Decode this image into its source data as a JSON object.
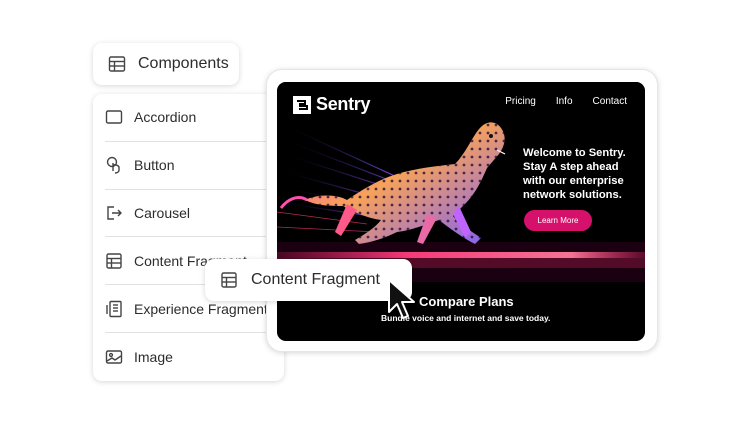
{
  "components_header": {
    "label": "Components",
    "icon": "table-icon"
  },
  "components": [
    {
      "label": "Accordion",
      "icon": "accordion-icon"
    },
    {
      "label": "Button",
      "icon": "button-icon"
    },
    {
      "label": "Carousel",
      "icon": "carousel-icon"
    },
    {
      "label": "Content Fragment",
      "icon": "content-fragment-icon"
    },
    {
      "label": "Experience Fragment",
      "icon": "experience-fragment-icon"
    },
    {
      "label": "Image",
      "icon": "image-icon"
    }
  ],
  "drag_card": {
    "label": "Content Fragment",
    "icon": "content-fragment-icon"
  },
  "preview": {
    "brand": "Sentry",
    "nav": [
      "Pricing",
      "Info",
      "Contact"
    ],
    "hero_lines": [
      "Welcome to Sentry.",
      "Stay A step ahead",
      "with our enterprise",
      "network solutions."
    ],
    "cta_label": "Learn More",
    "compare_title": "Compare Plans",
    "compare_subtitle": "Bundle voice and internet and save today."
  },
  "colors": {
    "accent": "#d6116b",
    "text": "#2c2c2c",
    "preview_bg": "#000000"
  }
}
